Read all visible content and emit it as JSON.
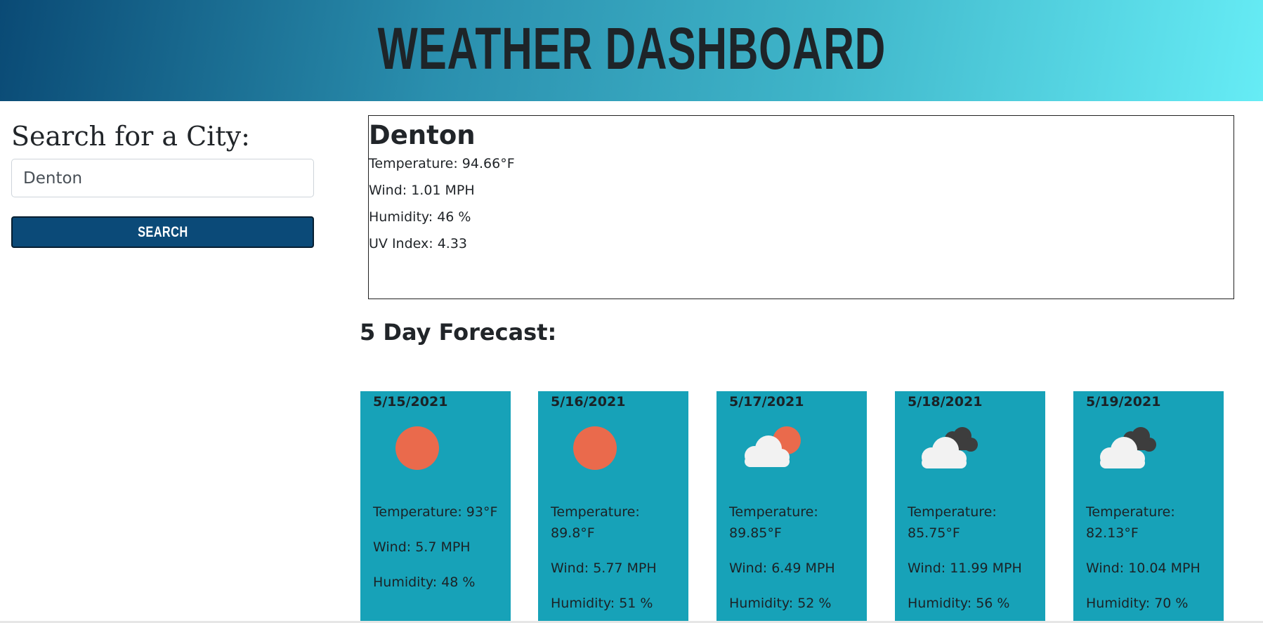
{
  "header": {
    "title": "WEATHER DASHBOARD"
  },
  "sidebar": {
    "title": "Search for a City:",
    "input_value": "Denton",
    "button_label": "Search"
  },
  "current": {
    "city": "Denton",
    "temperature": "Temperature: 94.66°F",
    "wind": "Wind: 1.01 MPH",
    "humidity": "Humidity: 46 %",
    "uv": "UV Index: 4.33"
  },
  "forecast": {
    "heading": "5 Day Forecast:",
    "days": [
      {
        "date": "5/15/2021",
        "icon": "sun-icon",
        "temperature": "Temperature: 93°F",
        "wind": "Wind: 5.7 MPH",
        "humidity": "Humidity: 48 %"
      },
      {
        "date": "5/16/2021",
        "icon": "sun-icon",
        "temperature": "Temperature: 89.8°F",
        "wind": "Wind: 5.77 MPH",
        "humidity": "Humidity: 51 %"
      },
      {
        "date": "5/17/2021",
        "icon": "partly-cloudy-icon",
        "temperature": "Temperature: 89.85°F",
        "wind": "Wind: 6.49 MPH",
        "humidity": "Humidity: 52 %"
      },
      {
        "date": "5/18/2021",
        "icon": "broken-clouds-icon",
        "temperature": "Temperature: 85.75°F",
        "wind": "Wind: 11.99 MPH",
        "humidity": "Humidity: 56 %"
      },
      {
        "date": "5/19/2021",
        "icon": "broken-clouds-icon",
        "temperature": "Temperature: 82.13°F",
        "wind": "Wind: 10.04 MPH",
        "humidity": "Humidity: 70 %"
      }
    ]
  },
  "colors": {
    "header_dark": "#0a4a75",
    "header_light": "#66ecf5",
    "button": "#0b4a78",
    "card": "#17a2b8",
    "sun": "#ea6a4c"
  }
}
